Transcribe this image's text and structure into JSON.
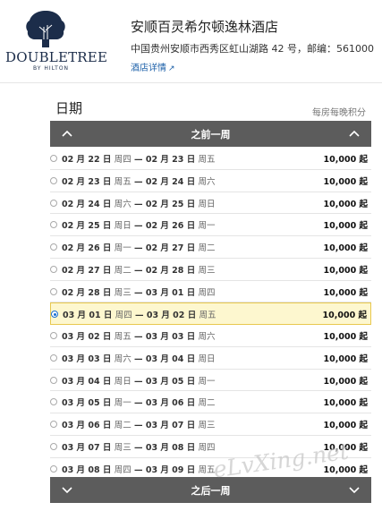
{
  "hotel": {
    "name": "安顺百灵希尔顿逸林酒店",
    "address": "中国贵州安顺市西秀区虹山湖路 42 号，邮编：561000",
    "details_link": "酒店详情",
    "logo_word": "DOUBLETREE",
    "logo_sub": "BY HILTON"
  },
  "section": {
    "title": "日期",
    "points_label": "每房每晚积分"
  },
  "nav": {
    "prev_week": "之前一周",
    "next_week": "之后一周"
  },
  "stays": [
    {
      "checkin": "02 月 22 日",
      "checkin_day": "周四",
      "checkout": "02 月 23 日",
      "checkout_day": "周五",
      "points": "10,000 起",
      "selected": false
    },
    {
      "checkin": "02 月 23 日",
      "checkin_day": "周五",
      "checkout": "02 月 24 日",
      "checkout_day": "周六",
      "points": "10,000 起",
      "selected": false
    },
    {
      "checkin": "02 月 24 日",
      "checkin_day": "周六",
      "checkout": "02 月 25 日",
      "checkout_day": "周日",
      "points": "10,000 起",
      "selected": false
    },
    {
      "checkin": "02 月 25 日",
      "checkin_day": "周日",
      "checkout": "02 月 26 日",
      "checkout_day": "周一",
      "points": "10,000 起",
      "selected": false
    },
    {
      "checkin": "02 月 26 日",
      "checkin_day": "周一",
      "checkout": "02 月 27 日",
      "checkout_day": "周二",
      "points": "10,000 起",
      "selected": false
    },
    {
      "checkin": "02 月 27 日",
      "checkin_day": "周二",
      "checkout": "02 月 28 日",
      "checkout_day": "周三",
      "points": "10,000 起",
      "selected": false
    },
    {
      "checkin": "02 月 28 日",
      "checkin_day": "周三",
      "checkout": "03 月 01 日",
      "checkout_day": "周四",
      "points": "10,000 起",
      "selected": false
    },
    {
      "checkin": "03 月 01 日",
      "checkin_day": "周四",
      "checkout": "03 月 02 日",
      "checkout_day": "周五",
      "points": "10,000 起",
      "selected": true
    },
    {
      "checkin": "03 月 02 日",
      "checkin_day": "周五",
      "checkout": "03 月 03 日",
      "checkout_day": "周六",
      "points": "10,000 起",
      "selected": false
    },
    {
      "checkin": "03 月 03 日",
      "checkin_day": "周六",
      "checkout": "03 月 04 日",
      "checkout_day": "周日",
      "points": "10,000 起",
      "selected": false
    },
    {
      "checkin": "03 月 04 日",
      "checkin_day": "周日",
      "checkout": "03 月 05 日",
      "checkout_day": "周一",
      "points": "10,000 起",
      "selected": false
    },
    {
      "checkin": "03 月 05 日",
      "checkin_day": "周一",
      "checkout": "03 月 06 日",
      "checkout_day": "周二",
      "points": "10,000 起",
      "selected": false
    },
    {
      "checkin": "03 月 06 日",
      "checkin_day": "周二",
      "checkout": "03 月 07 日",
      "checkout_day": "周三",
      "points": "10,000 起",
      "selected": false
    },
    {
      "checkin": "03 月 07 日",
      "checkin_day": "周三",
      "checkout": "03 月 08 日",
      "checkout_day": "周四",
      "points": "10,000 起",
      "selected": false
    },
    {
      "checkin": "03 月 08 日",
      "checkin_day": "周四",
      "checkout": "03 月 09 日",
      "checkout_day": "周五",
      "points": "10,000 起",
      "selected": false
    }
  ],
  "watermark": "eLvXing.net",
  "icons": {
    "logo": "tree-icon",
    "prev": "chevron-up-icon",
    "next": "chevron-down-icon",
    "external": "external-link-icon"
  }
}
